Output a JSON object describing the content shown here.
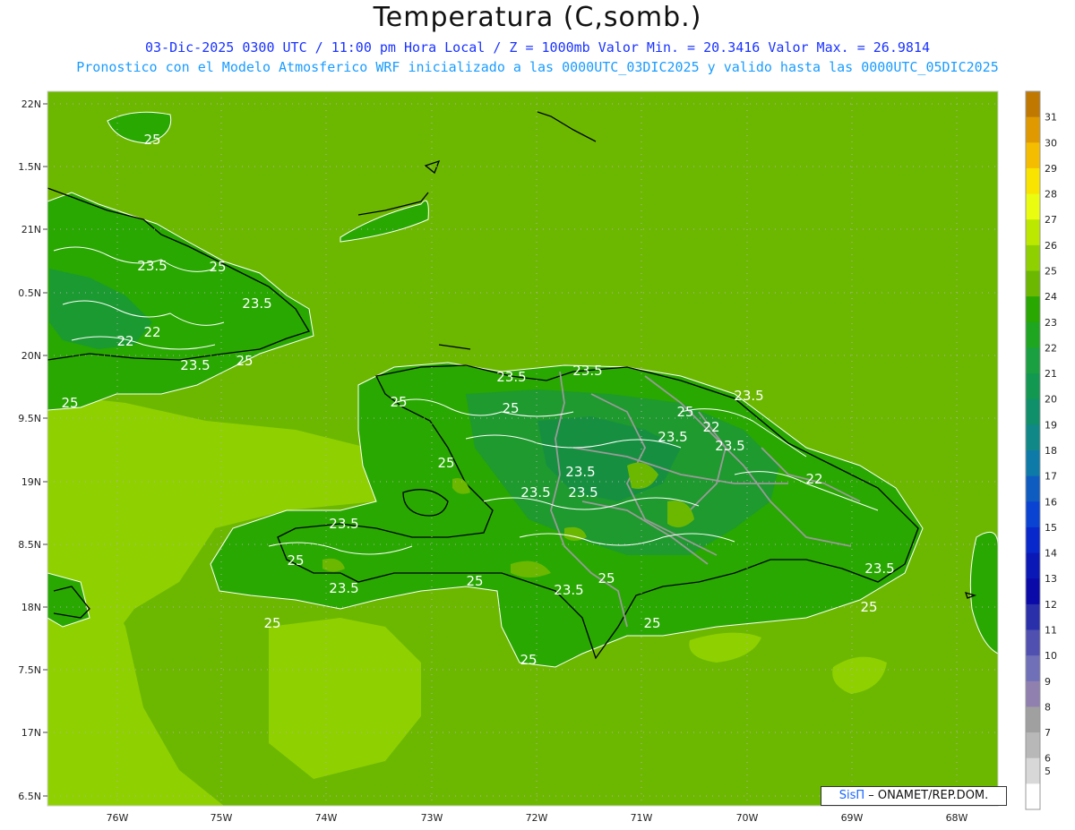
{
  "header": {
    "title": "Temperatura (C,somb.)",
    "line1": "03-Dic-2025 0300 UTC / 11:00 pm Hora Local / Z = 1000mb  Valor Min. = 20.3416  Valor Max. = 26.9814",
    "line2": "Pronostico con el Modelo Atmosferico WRF inicializado a las 0000UTC_03DIC2025 y valido hasta las  0000UTC_05DIC2025"
  },
  "map": {
    "lat_ticks": [
      "22N",
      "1.5N",
      "21N",
      "0.5N",
      "20N",
      "9.5N",
      "19N",
      "8.5N",
      "18N",
      "7.5N",
      "17N",
      "6.5N"
    ],
    "lon_ticks": [
      "76W",
      "75W",
      "74W",
      "73W",
      "72W",
      "71W",
      "70W",
      "69W",
      "68W"
    ],
    "contour_labels": [
      "25",
      "23.5",
      "25",
      "23.5",
      "22",
      "22",
      "23.5",
      "25",
      "25",
      "25",
      "23.5",
      "25",
      "23.5",
      "25",
      "23.5",
      "23.5",
      "23.5",
      "22",
      "23.5",
      "23.5",
      "22",
      "23.5",
      "23.5",
      "25",
      "23.5",
      "25",
      "23.5",
      "25",
      "25",
      "25",
      "25",
      "25",
      "23.5",
      "25"
    ]
  },
  "colorbar": {
    "labels": [
      "31",
      "30",
      "29",
      "28",
      "27",
      "26",
      "25",
      "24",
      "23",
      "22",
      "21",
      "20",
      "19",
      "18",
      "17",
      "16",
      "15",
      "14",
      "13",
      "12",
      "11",
      "10",
      "9",
      "8",
      "7",
      "6",
      "5"
    ],
    "colors": [
      "#c07800",
      "#e09a00",
      "#f5bd00",
      "#f9e400",
      "#eafd11",
      "#bce800",
      "#8fd000",
      "#6cb800",
      "#28a800",
      "#1ea621",
      "#1aa040",
      "#129850",
      "#10906a",
      "#108888",
      "#0e7aa8",
      "#0e5cc0",
      "#0a42d2",
      "#0828cc",
      "#0a18b6",
      "#0a0aa8",
      "#2a30aa",
      "#5050b0",
      "#7070b8",
      "#9080b0",
      "#a0a0a0",
      "#b8b8b8",
      "#d8d8d8",
      "#ffffff"
    ]
  },
  "credit": {
    "brand": "SisΠ",
    "text": " – ONAMET/REP.DOM."
  }
}
